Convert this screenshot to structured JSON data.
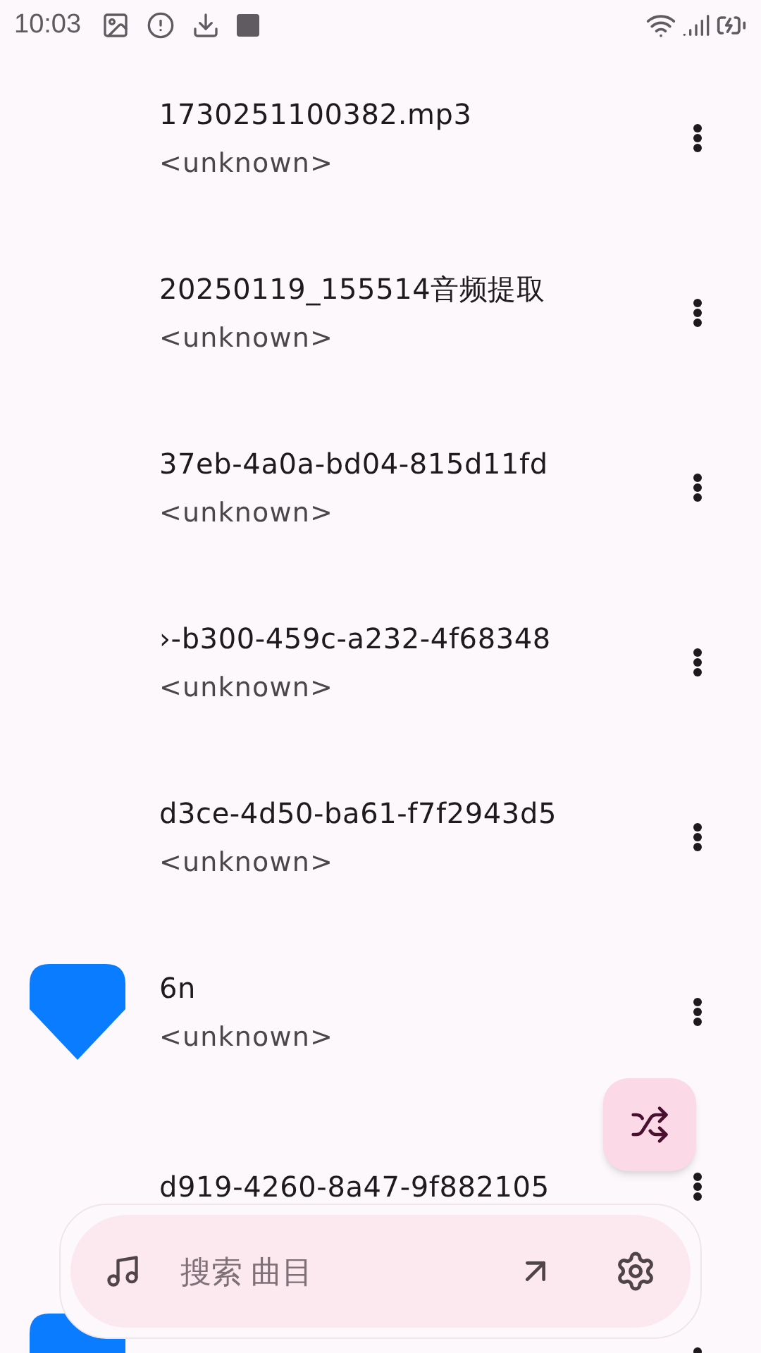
{
  "status_bar": {
    "time": "10:03"
  },
  "songs": [
    {
      "title": "1730251100382.mp3",
      "artist": "<unknown>",
      "has_artwork": false
    },
    {
      "title": "20250119_155514音频提取",
      "artist": "<unknown>",
      "has_artwork": false
    },
    {
      "title": "37eb-4a0a-bd04-815d11fd",
      "artist": "<unknown>",
      "has_artwork": false
    },
    {
      "title": "›-b300-459c-a232-4f68348",
      "artist": "<unknown>",
      "has_artwork": false
    },
    {
      "title": "d3ce-4d50-ba61-f7f2943d5",
      "artist": "<unknown>",
      "has_artwork": false
    },
    {
      "title": "6n",
      "artist": "<unknown>",
      "has_artwork": true
    },
    {
      "title": "d919-4260-8a47-9f882105",
      "has_artwork": false
    },
    {
      "has_artwork": true
    }
  ],
  "search": {
    "placeholder": "搜索 曲目"
  }
}
